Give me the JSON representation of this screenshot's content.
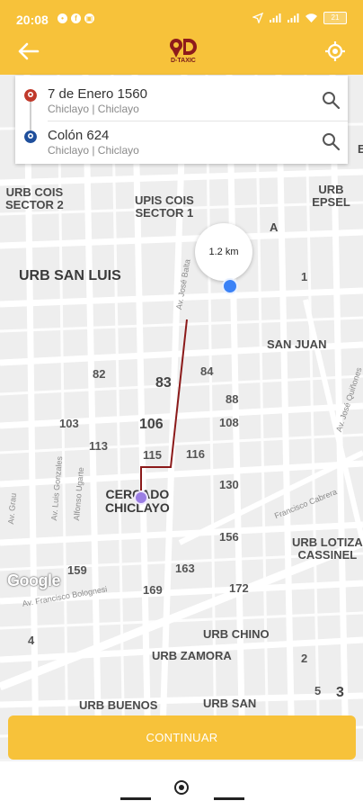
{
  "status_bar": {
    "time": "20:08",
    "battery": "21"
  },
  "header": {
    "logo_text": "D-TAXIC",
    "accent": "#F7C23A"
  },
  "origin": {
    "title": "7 de Enero 1560",
    "subtitle": "Chiclayo | Chiclayo",
    "color": "#c0392b"
  },
  "destination": {
    "title": "Colón 624",
    "subtitle": "Chiclayo | Chiclayo",
    "color": "#1f4f9c"
  },
  "map": {
    "distance": "1.2 km",
    "watermark": "Google",
    "labels": {
      "urb_cois": "URB COIS\nSECTOR 2",
      "upis_cois": "UPIS COIS\nSECTOR 1",
      "urb_epsel": "URB EPSEL",
      "urb_san_luis": "URB SAN LUIS",
      "san_juan": "SAN JUAN",
      "cercado": "CERCADO\nCHICLAYO",
      "urb_lotiza": "URB LOTIZA\nCASSINEL",
      "urb_chino": "URB CHINO",
      "urb_zamora": "URB ZAMORA",
      "urb_buenos": "URB BUENOS",
      "urb_san": "URB SAN",
      "a": "A",
      "e": "E"
    },
    "numbers": {
      "n1": "1",
      "n82": "82",
      "n83": "83",
      "n84": "84",
      "n88": "88",
      "n103": "103",
      "n106": "106",
      "n108": "108",
      "n113": "113",
      "n115": "115",
      "n116": "116",
      "n130": "130",
      "n156": "156",
      "n159": "159",
      "n163": "163",
      "n169": "169",
      "n172": "172",
      "n4": "4",
      "n2": "2",
      "n5": "5",
      "n3": "3"
    },
    "streets": {
      "jose_balta": "Av. José Balta",
      "jose_quinones": "Av. José Quiñones",
      "francisco_cabrera": "Francisco Cabrera",
      "francisco_bolognesi": "Av. Francisco Bolognesi",
      "luis_gonzales": "Av. Luis Gonzales",
      "alfonso_ugarte": "Alfonso Ugarte",
      "grau": "Av. Grau"
    }
  },
  "actions": {
    "continue_label": "CONTINUAR"
  }
}
